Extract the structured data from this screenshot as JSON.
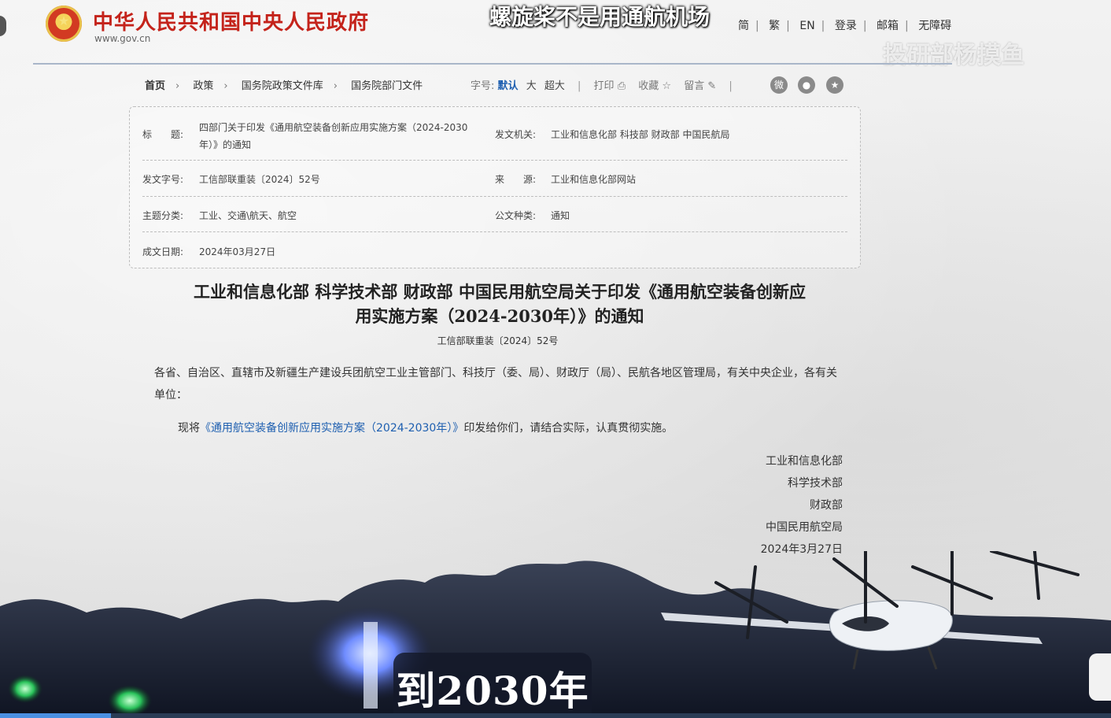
{
  "site": {
    "title": "中华人民共和国中央人民政府",
    "url": "www.gov.cn",
    "top_links": [
      "简",
      "繁",
      "EN",
      "登录",
      "邮箱",
      "无障碍"
    ]
  },
  "overlays": {
    "top_subtitle": "螺旋桨不是用通航机场",
    "watermark": "投研部杨摸鱼",
    "caption": "到2030年"
  },
  "breadcrumb": [
    "首页",
    "政策",
    "国务院政策文件库",
    "国务院部门文件"
  ],
  "toolbar": {
    "font_label": "字号:",
    "font_default": "默认",
    "font_large": "大",
    "font_xlarge": "超大",
    "print": "打印",
    "favorite": "收藏",
    "comment": "留言"
  },
  "meta": {
    "title_label": "标　　题:",
    "title_value_line1": "四部门关于印发《通用航空装备创新应用实施方案（2024-2030",
    "title_value_line2": "年）》的通知",
    "issuer_label": "发文机关:",
    "issuer_value": "工业和信息化部 科技部 财政部 中国民航局",
    "doc_no_label": "发文字号:",
    "doc_no_value": "工信部联重装〔2024〕52号",
    "source_label": "来　　源:",
    "source_value": "工业和信息化部网站",
    "topic_label": "主题分类:",
    "topic_value": "工业、交通\\航天、航空",
    "type_label": "公文种类:",
    "type_value": "通知",
    "date_label": "成文日期:",
    "date_value": "2024年03月27日"
  },
  "document": {
    "title_line1": "工业和信息化部 科学技术部 财政部 中国民用航空局关于印发《通用航空装备创新应",
    "title_line2": "用实施方案（2024-2030年）》的通知",
    "doc_number": "工信部联重装〔2024〕52号",
    "para1": "各省、自治区、直辖市及新疆生产建设兵团航空工业主管部门、科技厅（委、局）、财政厅（局）、民航各地区管理局，有关中央企业，各有关单位：",
    "para2_prefix": "现将",
    "para2_link": "《通用航空装备创新应用实施方案（2024-2030年）》",
    "para2_suffix": "印发给你们，请结合实际，认真贯彻实施。",
    "signatures": [
      "工业和信息化部",
      "科学技术部",
      "财政部",
      "中国民用航空局",
      "2024年3月27日"
    ]
  },
  "video": {
    "progress_fraction": 0.1
  },
  "colors": {
    "brand_red": "#c4231b",
    "link_blue": "#1e5fb0"
  }
}
